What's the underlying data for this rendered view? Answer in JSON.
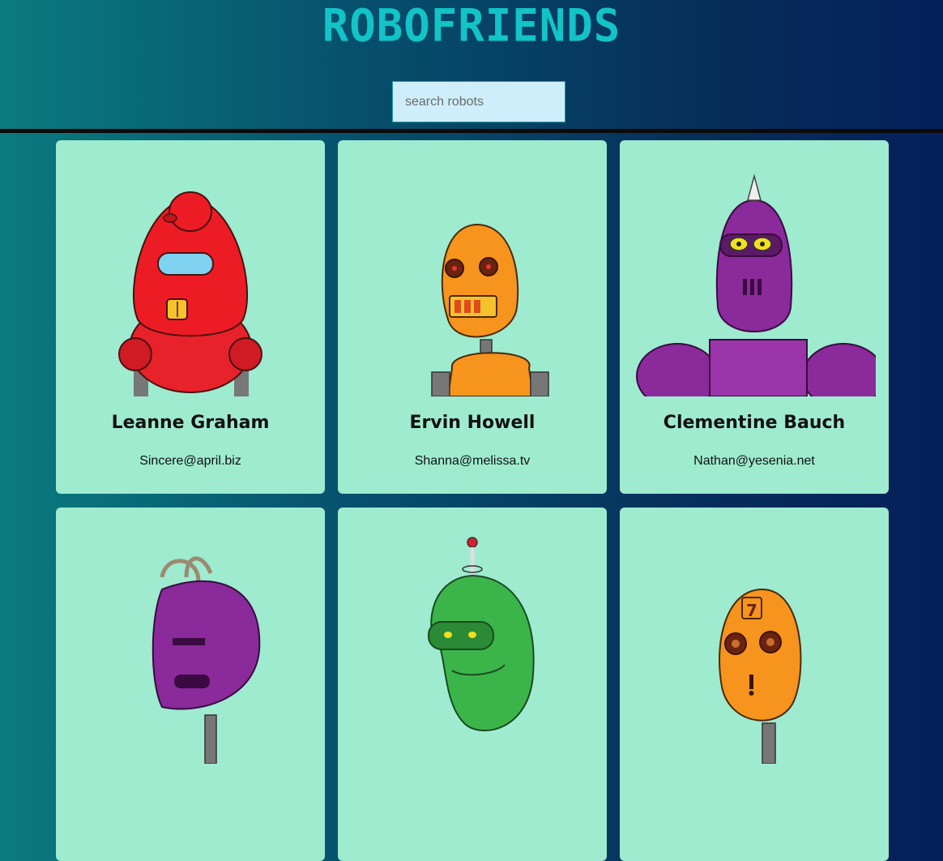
{
  "header": {
    "title": "ROBOFRIENDS",
    "search": {
      "placeholder": "search robots",
      "value": ""
    }
  },
  "robots": [
    {
      "name": "Leanne Graham",
      "email": "Sincere@april.biz",
      "icon": "red-robot-avatar"
    },
    {
      "name": "Ervin Howell",
      "email": "Shanna@melissa.tv",
      "icon": "orange-robot-avatar"
    },
    {
      "name": "Clementine Bauch",
      "email": "Nathan@yesenia.net",
      "icon": "purple-robot-avatar"
    },
    {
      "name": "",
      "email": "",
      "icon": "purple-feather-robot-avatar"
    },
    {
      "name": "",
      "email": "",
      "icon": "green-antenna-robot-avatar"
    },
    {
      "name": "",
      "email": "",
      "icon": "orange-seven-robot-avatar"
    }
  ],
  "colors": {
    "card": "#9eebd0",
    "title": "#12c3c7",
    "search_bg": "#cfeefc",
    "divider": "#0a0a0a"
  }
}
